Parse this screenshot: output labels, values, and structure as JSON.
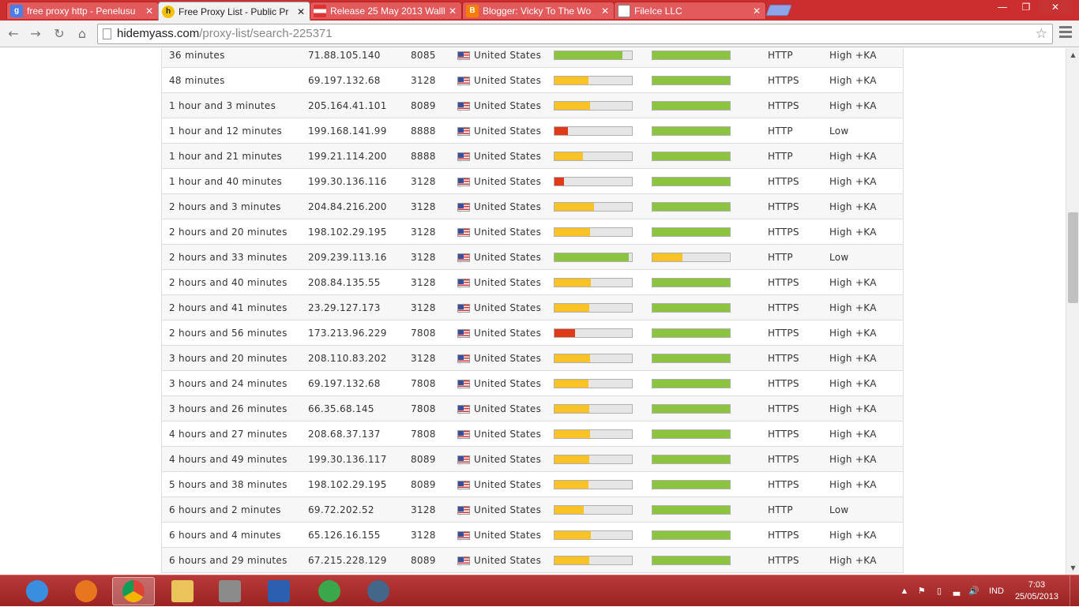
{
  "browser": {
    "tabs": [
      {
        "title": "free proxy http - Penelusu",
        "favicon": "google-icon",
        "favicon_color": "#4a7de8",
        "favicon_char": "g",
        "active": false
      },
      {
        "title": "Free Proxy List - Public Pr",
        "favicon": "hidemyass-icon",
        "favicon_color": "#f2c200",
        "favicon_char": "h",
        "active": true
      },
      {
        "title": "Release 25 May 2013 Walll",
        "favicon": "flag-icon",
        "favicon_color": "#dd3333",
        "favicon_char": "",
        "active": false
      },
      {
        "title": "Blogger: Vicky To The Wo",
        "favicon": "blogger-icon",
        "favicon_color": "#f57d00",
        "favicon_char": "B",
        "active": false
      },
      {
        "title": "FileIce LLC",
        "favicon": "page-icon",
        "favicon_color": "#ffffff",
        "favicon_char": "",
        "active": false
      }
    ],
    "url_host": "hidemyass.com",
    "url_path": "/proxy-list/search-225371"
  },
  "colors": {
    "green": "#8dc43f",
    "yellow": "#fdc326",
    "red": "#e03a1b"
  },
  "proxies": [
    {
      "time": "36 minutes",
      "ip": "71.88.105.140",
      "port": "8085",
      "country": "United States",
      "speed": 0.88,
      "speed_color": "green",
      "conn": 1.0,
      "conn_color": "green",
      "type": "HTTP",
      "anon": "High +KA"
    },
    {
      "time": "48 minutes",
      "ip": "69.197.132.68",
      "port": "3128",
      "country": "United States",
      "speed": 0.44,
      "speed_color": "yellow",
      "conn": 1.0,
      "conn_color": "green",
      "type": "HTTPS",
      "anon": "High +KA"
    },
    {
      "time": "1 hour and 3 minutes",
      "ip": "205.164.41.101",
      "port": "8089",
      "country": "United States",
      "speed": 0.46,
      "speed_color": "yellow",
      "conn": 1.0,
      "conn_color": "green",
      "type": "HTTPS",
      "anon": "High +KA"
    },
    {
      "time": "1 hour and 12 minutes",
      "ip": "199.168.141.99",
      "port": "8888",
      "country": "United States",
      "speed": 0.17,
      "speed_color": "red",
      "conn": 1.0,
      "conn_color": "green",
      "type": "HTTP",
      "anon": "Low"
    },
    {
      "time": "1 hour and 21 minutes",
      "ip": "199.21.114.200",
      "port": "8888",
      "country": "United States",
      "speed": 0.37,
      "speed_color": "yellow",
      "conn": 1.0,
      "conn_color": "green",
      "type": "HTTP",
      "anon": "High +KA"
    },
    {
      "time": "1 hour and 40 minutes",
      "ip": "199.30.136.116",
      "port": "3128",
      "country": "United States",
      "speed": 0.12,
      "speed_color": "red",
      "conn": 1.0,
      "conn_color": "green",
      "type": "HTTPS",
      "anon": "High +KA"
    },
    {
      "time": "2 hours and 3 minutes",
      "ip": "204.84.216.200",
      "port": "3128",
      "country": "United States",
      "speed": 0.51,
      "speed_color": "yellow",
      "conn": 1.0,
      "conn_color": "green",
      "type": "HTTPS",
      "anon": "High +KA"
    },
    {
      "time": "2 hours and 20 minutes",
      "ip": "198.102.29.195",
      "port": "3128",
      "country": "United States",
      "speed": 0.46,
      "speed_color": "yellow",
      "conn": 1.0,
      "conn_color": "green",
      "type": "HTTPS",
      "anon": "High +KA"
    },
    {
      "time": "2 hours and 33 minutes",
      "ip": "209.239.113.16",
      "port": "3128",
      "country": "United States",
      "speed": 0.96,
      "speed_color": "green",
      "conn": 0.39,
      "conn_color": "yellow",
      "type": "HTTP",
      "anon": "Low"
    },
    {
      "time": "2 hours and 40 minutes",
      "ip": "208.84.135.55",
      "port": "3128",
      "country": "United States",
      "speed": 0.47,
      "speed_color": "yellow",
      "conn": 1.0,
      "conn_color": "green",
      "type": "HTTPS",
      "anon": "High +KA"
    },
    {
      "time": "2 hours and 41 minutes",
      "ip": "23.29.127.173",
      "port": "3128",
      "country": "United States",
      "speed": 0.45,
      "speed_color": "yellow",
      "conn": 1.0,
      "conn_color": "green",
      "type": "HTTPS",
      "anon": "High +KA"
    },
    {
      "time": "2 hours and 56 minutes",
      "ip": "173.213.96.229",
      "port": "7808",
      "country": "United States",
      "speed": 0.27,
      "speed_color": "red",
      "conn": 1.0,
      "conn_color": "green",
      "type": "HTTPS",
      "anon": "High +KA"
    },
    {
      "time": "3 hours and 20 minutes",
      "ip": "208.110.83.202",
      "port": "3128",
      "country": "United States",
      "speed": 0.46,
      "speed_color": "yellow",
      "conn": 1.0,
      "conn_color": "green",
      "type": "HTTPS",
      "anon": "High +KA"
    },
    {
      "time": "3 hours and 24 minutes",
      "ip": "69.197.132.68",
      "port": "7808",
      "country": "United States",
      "speed": 0.44,
      "speed_color": "yellow",
      "conn": 1.0,
      "conn_color": "green",
      "type": "HTTPS",
      "anon": "High +KA"
    },
    {
      "time": "3 hours and 26 minutes",
      "ip": "66.35.68.145",
      "port": "7808",
      "country": "United States",
      "speed": 0.45,
      "speed_color": "yellow",
      "conn": 1.0,
      "conn_color": "green",
      "type": "HTTPS",
      "anon": "High +KA"
    },
    {
      "time": "4 hours and 27 minutes",
      "ip": "208.68.37.137",
      "port": "7808",
      "country": "United States",
      "speed": 0.46,
      "speed_color": "yellow",
      "conn": 1.0,
      "conn_color": "green",
      "type": "HTTPS",
      "anon": "High +KA"
    },
    {
      "time": "4 hours and 49 minutes",
      "ip": "199.30.136.117",
      "port": "8089",
      "country": "United States",
      "speed": 0.45,
      "speed_color": "yellow",
      "conn": 1.0,
      "conn_color": "green",
      "type": "HTTPS",
      "anon": "High +KA"
    },
    {
      "time": "5 hours and 38 minutes",
      "ip": "198.102.29.195",
      "port": "8089",
      "country": "United States",
      "speed": 0.44,
      "speed_color": "yellow",
      "conn": 1.0,
      "conn_color": "green",
      "type": "HTTPS",
      "anon": "High +KA"
    },
    {
      "time": "6 hours and 2 minutes",
      "ip": "69.72.202.52",
      "port": "3128",
      "country": "United States",
      "speed": 0.38,
      "speed_color": "yellow",
      "conn": 1.0,
      "conn_color": "green",
      "type": "HTTP",
      "anon": "Low"
    },
    {
      "time": "6 hours and 4 minutes",
      "ip": "65.126.16.155",
      "port": "3128",
      "country": "United States",
      "speed": 0.47,
      "speed_color": "yellow",
      "conn": 1.0,
      "conn_color": "green",
      "type": "HTTPS",
      "anon": "High +KA"
    },
    {
      "time": "6 hours and 29 minutes",
      "ip": "67.215.228.129",
      "port": "8089",
      "country": "United States",
      "speed": 0.45,
      "speed_color": "yellow",
      "conn": 1.0,
      "conn_color": "green",
      "type": "HTTPS",
      "anon": "High +KA"
    }
  ],
  "taskbar": {
    "apps": [
      {
        "name": "internet-explorer-icon",
        "color": "#3a8ee0",
        "active": false
      },
      {
        "name": "firefox-icon",
        "color": "#e8761e",
        "active": false
      },
      {
        "name": "chrome-icon",
        "color": "#4caf50",
        "active": true
      },
      {
        "name": "explorer-folder-icon",
        "color": "#e8c45a",
        "active": false
      },
      {
        "name": "firewall-icon",
        "color": "#8b8b8b",
        "active": false
      },
      {
        "name": "word-icon",
        "color": "#2b5fb0",
        "active": false
      },
      {
        "name": "ahe-icon",
        "color": "#3aa84a",
        "active": false
      },
      {
        "name": "webcam-icon",
        "color": "#446688",
        "active": false
      }
    ],
    "language": "IND",
    "time": "7:03",
    "date": "25/05/2013"
  }
}
